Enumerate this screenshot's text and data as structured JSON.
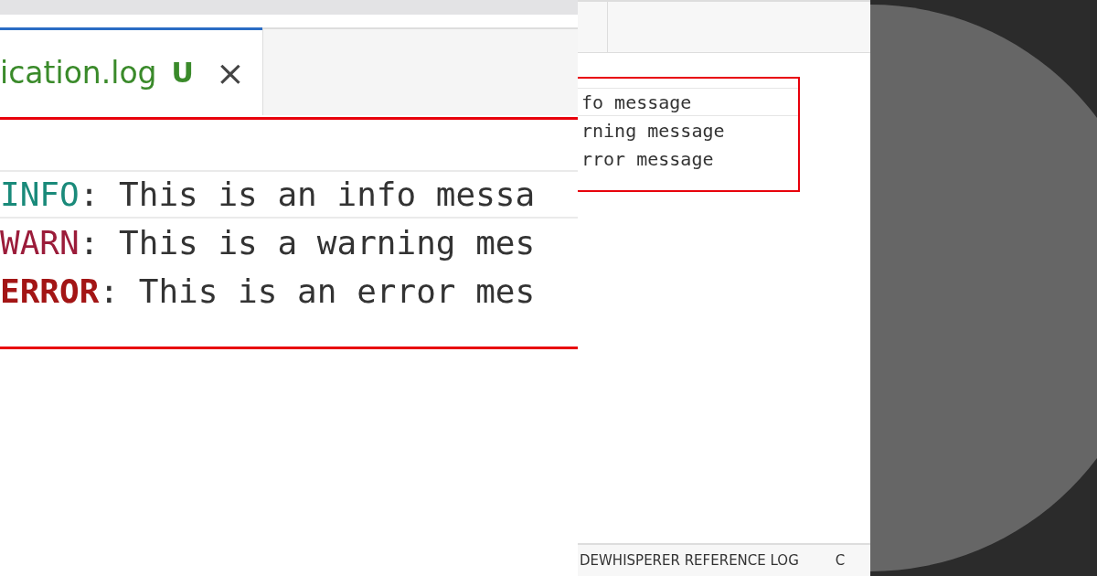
{
  "zoomed_editor": {
    "tab": {
      "filename": "ication.log",
      "status": "U",
      "close": "×",
      "selected": true
    },
    "lines": [
      {
        "kind": "info",
        "label": "INFO",
        "text": ": This is an info messa",
        "highlighted": true
      },
      {
        "kind": "warn",
        "label": "WARN",
        "text": ": This is a warning mes",
        "highlighted": false
      },
      {
        "kind": "error",
        "label": "ERROR",
        "text": ": This is an error mes",
        "highlighted": false
      }
    ]
  },
  "overview": {
    "lines": [
      {
        "text": "fo message",
        "highlighted": true
      },
      {
        "text": "rning message",
        "highlighted": false
      },
      {
        "text": "rror message",
        "highlighted": false
      }
    ],
    "panel_tabs": [
      "DEWHISPERER REFERENCE LOG",
      "C"
    ]
  }
}
